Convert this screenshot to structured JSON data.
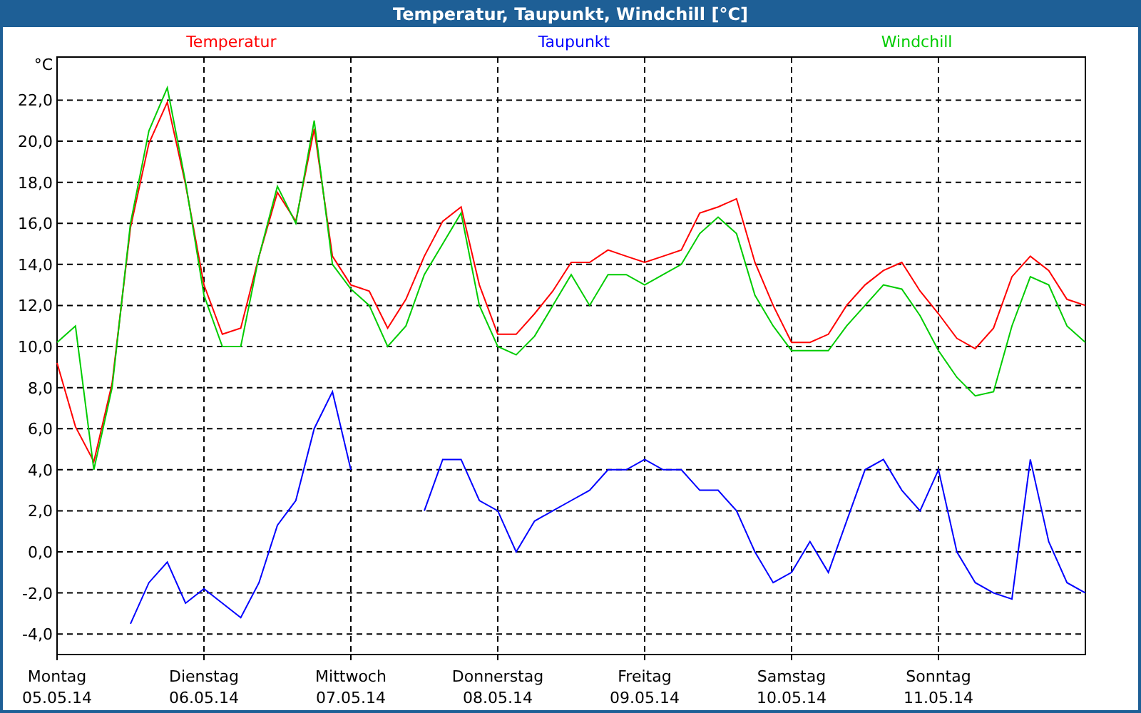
{
  "window": {
    "title": "Temperatur, Taupunkt, Windchill [°C]"
  },
  "chart": {
    "chart_data": {
      "type": "line",
      "grid": true,
      "ylabel": "°C",
      "ylim": [
        -5,
        24.1
      ],
      "categories": [
        "05.05.14",
        null,
        null,
        null,
        null,
        null,
        null,
        null,
        "06.05.14",
        null,
        null,
        null,
        null,
        null,
        null,
        null,
        "07.05.14",
        null,
        null,
        null,
        null,
        null,
        null,
        null,
        "08.05.14",
        null,
        null,
        null,
        null,
        null,
        null,
        null,
        "09.05.14",
        null,
        null,
        null,
        null,
        null,
        null,
        null,
        "10.05.14",
        null,
        null,
        null,
        null,
        null,
        null,
        null,
        "11.05.14",
        null,
        null,
        null,
        null,
        null,
        null,
        null,
        null
      ],
      "series": [
        {
          "name": "Temperatur",
          "color": "#ff0000",
          "values": [
            9.2,
            6.1,
            4.4,
            8.2,
            15.8,
            19.9,
            21.9,
            17.9,
            13.0,
            10.6,
            10.9,
            14.4,
            17.5,
            16.1,
            20.6,
            14.4,
            13.0,
            12.7,
            10.9,
            12.3,
            14.4,
            16.1,
            16.8,
            13.0,
            10.6,
            10.6,
            11.6,
            12.7,
            14.1,
            14.1,
            14.7,
            14.4,
            14.1,
            14.4,
            14.7,
            16.5,
            16.8,
            17.2,
            14.1,
            12.0,
            10.2,
            10.2,
            10.6,
            12.0,
            13.0,
            13.7,
            14.1,
            12.7,
            11.6,
            10.4,
            9.9,
            10.9,
            13.4,
            14.4,
            13.7,
            12.3,
            12.0
          ]
        },
        {
          "name": "Taupunkt",
          "color": "#0000ff",
          "values": [
            null,
            null,
            null,
            null,
            -3.5,
            -1.5,
            -0.5,
            -2.5,
            -1.8,
            -2.5,
            -3.2,
            -1.5,
            1.3,
            2.5,
            6.0,
            7.8,
            4.0,
            null,
            null,
            null,
            2.0,
            4.5,
            4.5,
            2.5,
            2.0,
            0.0,
            1.5,
            2.0,
            2.5,
            3.0,
            4.0,
            4.0,
            4.5,
            4.0,
            4.0,
            3.0,
            3.0,
            2.0,
            0.0,
            -1.5,
            -1.0,
            0.5,
            -1.0,
            1.5,
            4.0,
            4.5,
            3.0,
            2.0,
            4.0,
            0.0,
            -1.5,
            -2.0,
            -2.3,
            4.5,
            0.5,
            -1.5,
            -2.0
          ]
        },
        {
          "name": "Windchill",
          "color": "#00cc00",
          "values": [
            10.2,
            11.0,
            4.0,
            8.0,
            16.0,
            20.5,
            22.6,
            18.0,
            12.5,
            10.0,
            10.0,
            14.4,
            17.8,
            16.0,
            21.0,
            14.0,
            12.8,
            12.0,
            10.0,
            11.0,
            13.5,
            15.0,
            16.5,
            12.0,
            10.0,
            9.6,
            10.5,
            12.0,
            13.5,
            12.0,
            13.5,
            13.5,
            13.0,
            13.5,
            14.0,
            15.5,
            16.3,
            15.5,
            12.5,
            11.0,
            9.8,
            9.8,
            9.8,
            11.0,
            12.0,
            13.0,
            12.8,
            11.5,
            9.8,
            8.5,
            7.6,
            7.8,
            11.0,
            13.4,
            13.0,
            11.0,
            10.2
          ]
        }
      ],
      "yticks": [
        {
          "value": -4,
          "label": "-4,0"
        },
        {
          "value": -2,
          "label": "-2,0"
        },
        {
          "value": 0,
          "label": "0,0"
        },
        {
          "value": 2,
          "label": "2,0"
        },
        {
          "value": 4,
          "label": "4,0"
        },
        {
          "value": 6,
          "label": "6,0"
        },
        {
          "value": 8,
          "label": "8,0"
        },
        {
          "value": 10,
          "label": "10,0"
        },
        {
          "value": 12,
          "label": "12,0"
        },
        {
          "value": 14,
          "label": "14,0"
        },
        {
          "value": 16,
          "label": "16,0"
        },
        {
          "value": 18,
          "label": "18,0"
        },
        {
          "value": 20,
          "label": "20,0"
        },
        {
          "value": 22,
          "label": "22,0"
        }
      ]
    },
    "day_labels": [
      "Montag",
      "Dienstag",
      "Mittwoch",
      "Donnerstag",
      "Freitag",
      "Samstag",
      "Sonntag"
    ]
  }
}
